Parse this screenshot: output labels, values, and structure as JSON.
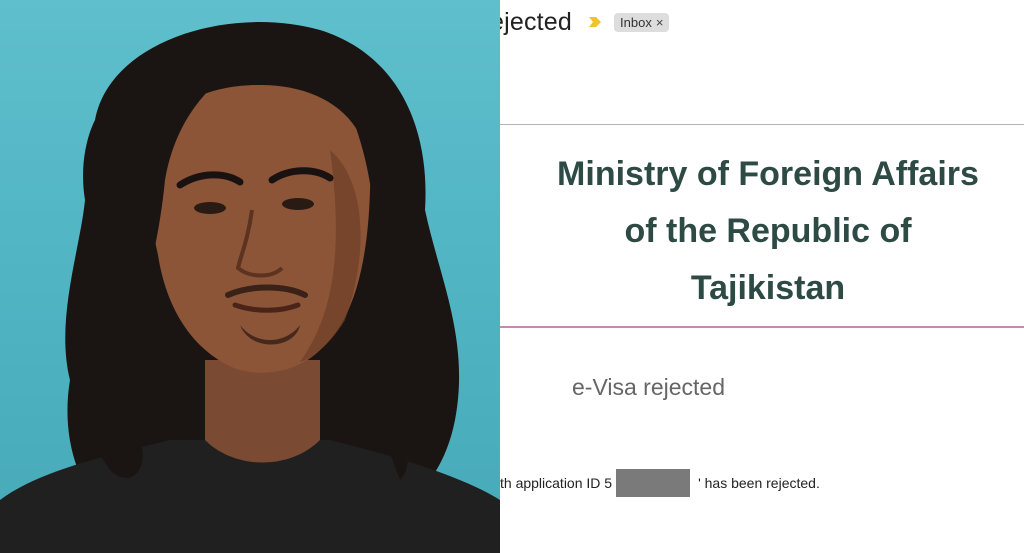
{
  "photo": {
    "description_icon": "portrait-photo"
  },
  "email": {
    "subject": "ejected",
    "label": "Inbox",
    "label_close": "×",
    "ministry_line1": "Ministry of Foreign Affairs",
    "ministry_line2": "of the Republic of",
    "ministry_line3": "Tajikistan",
    "evisa_status": "e-Visa rejected",
    "body_prefix": "th application ID 5",
    "body_suffix": "' has been rejected."
  },
  "colors": {
    "photo_bg": "#4fb3c2",
    "ministry_text": "#2e4a44",
    "rule_bottom": "#c58ab3",
    "redaction": "#7a7a7a",
    "importance_marker": "#f2c12e"
  }
}
